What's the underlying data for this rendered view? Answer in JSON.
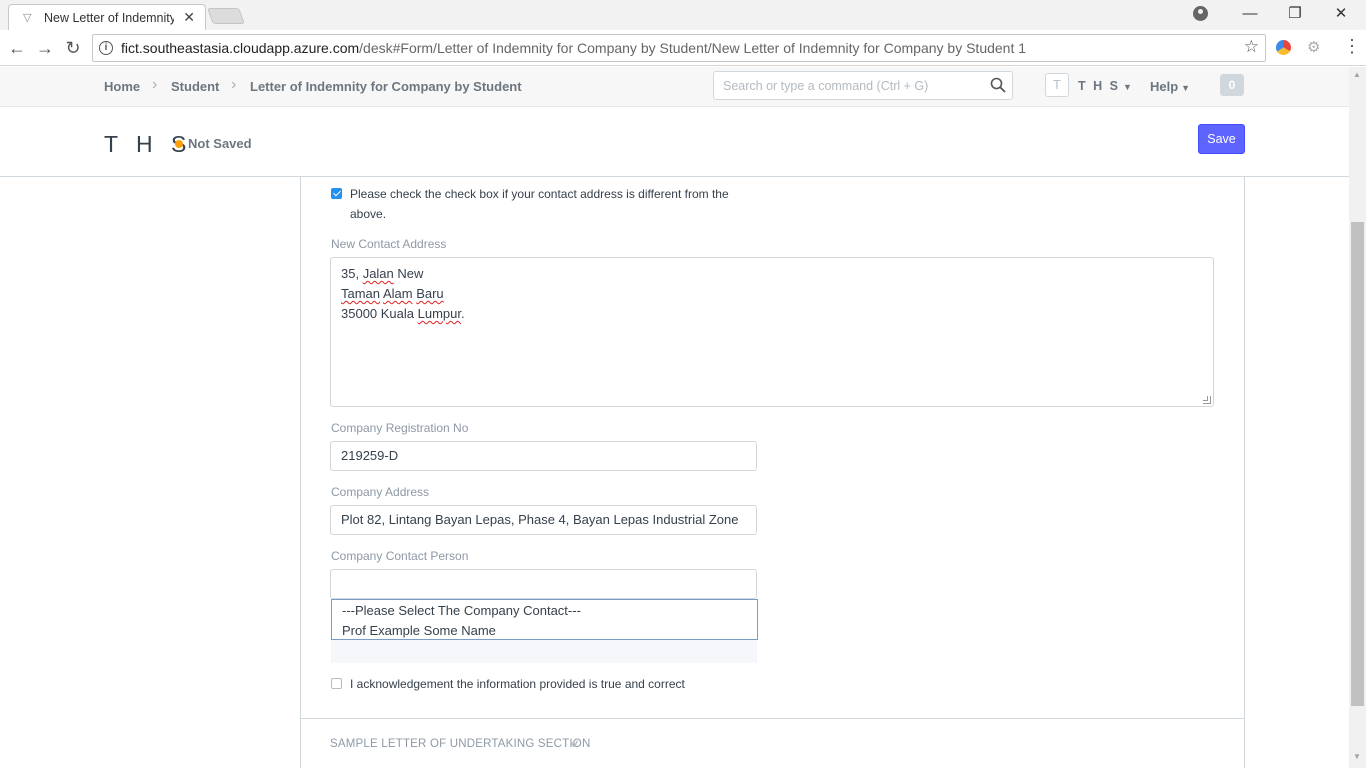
{
  "browser": {
    "tab_title": "New Letter of Indemnity",
    "tab_close": "✕",
    "url_host": "fict.southeastasia.cloudapp.azure.com",
    "url_path": "/desk#Form/Letter of Indemnity for Company by Student/New Letter of Indemnity for Company by Student 1",
    "window_minimize": "—",
    "window_restore": "❐",
    "window_close": "✕"
  },
  "navbar": {
    "breadcrumbs": [
      "Home",
      "Student",
      "Letter of Indemnity for Company by Student"
    ],
    "search_placeholder": "Search or type a command (Ctrl + G)",
    "avatar_letter": "T",
    "user_label": "T H S",
    "help_label": "Help",
    "notification_count": "0"
  },
  "page_head": {
    "title": "T H S",
    "status": "Not Saved",
    "status_color": "#ffa00a",
    "save_label": "Save",
    "accent_color": "#5e64ff"
  },
  "form": {
    "different_address_checkbox": {
      "checked": true,
      "label_line1": "Please check the check box if your contact address is different from the",
      "label_line2": "above."
    },
    "new_contact_address": {
      "label": "New Contact Address",
      "lines": [
        "35, Jalan New",
        "Taman Alam Baru",
        "35000 Kuala Lumpur."
      ],
      "line1_pre": "35, ",
      "line1_err": "Jalan",
      "line1_post": " New",
      "line2_err1": "Taman",
      "line2_err2": "Alam",
      "line2_err3": "Baru",
      "line3_pre": "35000 Kuala ",
      "line3_err": "Lumpur",
      "line3_post": "."
    },
    "company_registration_no": {
      "label": "Company Registration No",
      "value": "219259-D"
    },
    "company_address": {
      "label": "Company Address",
      "value": "Plot 82, Lintang Bayan Lepas, Phase 4, Bayan Lepas Industrial Zone"
    },
    "company_contact_person": {
      "label": "Company Contact Person",
      "value": "",
      "options": [
        "---Please Select The Company Contact---",
        "Prof Example Some Name"
      ]
    },
    "acknowledgement_checkbox": {
      "checked": false,
      "label": "I acknowledgement the information provided is true and correct"
    },
    "next_section": "SAMPLE LETTER OF UNDERTAKING SECTION"
  }
}
